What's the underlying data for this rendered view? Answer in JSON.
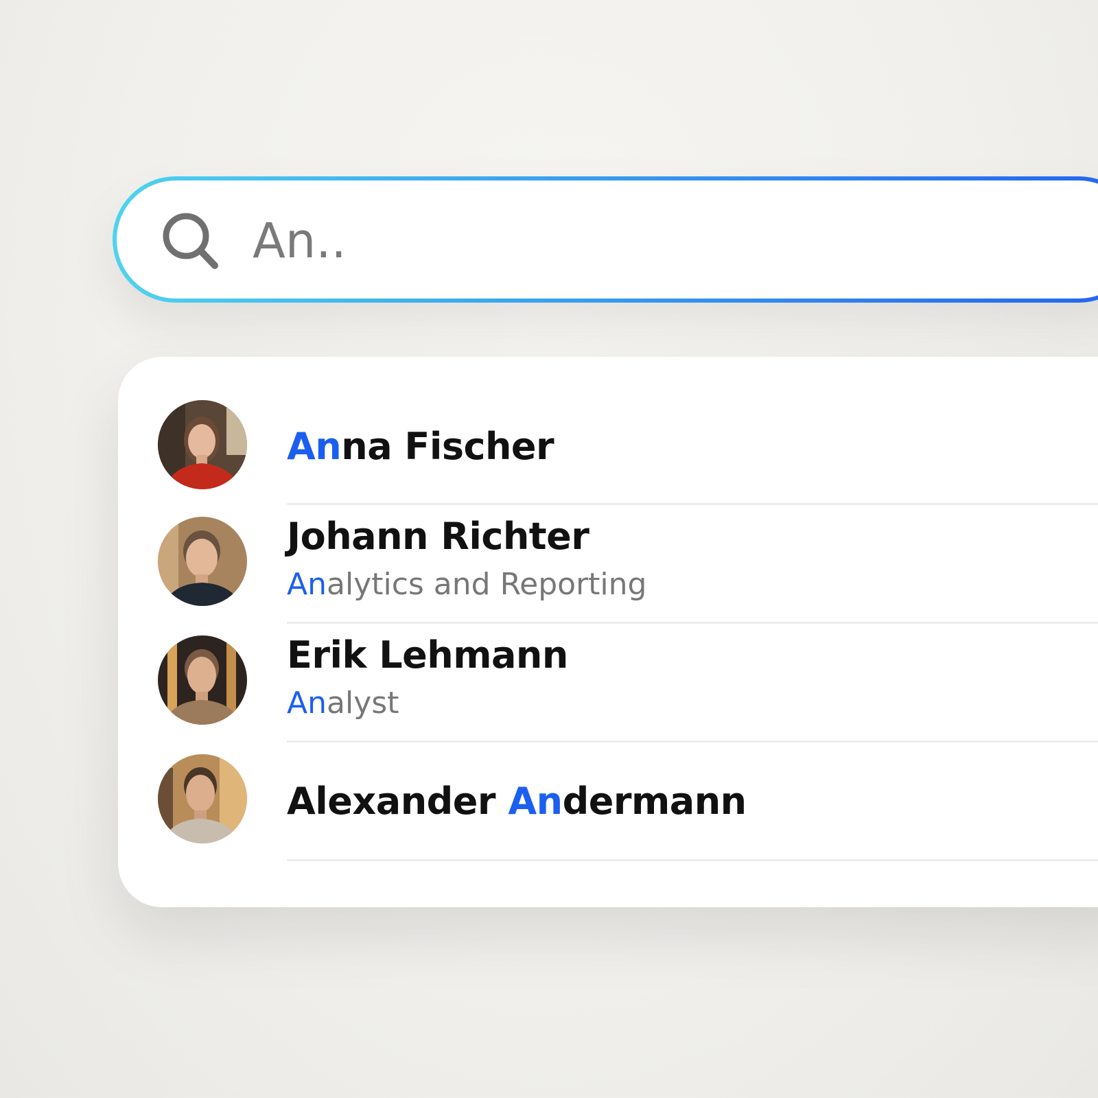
{
  "search": {
    "value": "An..",
    "icon": "search-icon",
    "border_gradient": [
      "#4fd3ee",
      "#2463ef"
    ]
  },
  "highlight_color": "#1c5ff0",
  "results": [
    {
      "name_highlight": "An",
      "name_rest": "na Fischer",
      "avatar": "avatar-anna"
    },
    {
      "name": "Johann Richter",
      "subtitle_highlight": "An",
      "subtitle_rest": "alytics and Reporting",
      "avatar": "avatar-johann"
    },
    {
      "name": "Erik Lehmann",
      "subtitle_highlight": "An",
      "subtitle_rest": "alyst",
      "avatar": "avatar-erik"
    },
    {
      "name_before": "Alexander ",
      "name_highlight": "An",
      "name_rest": "dermann",
      "avatar": "avatar-alexander"
    }
  ]
}
